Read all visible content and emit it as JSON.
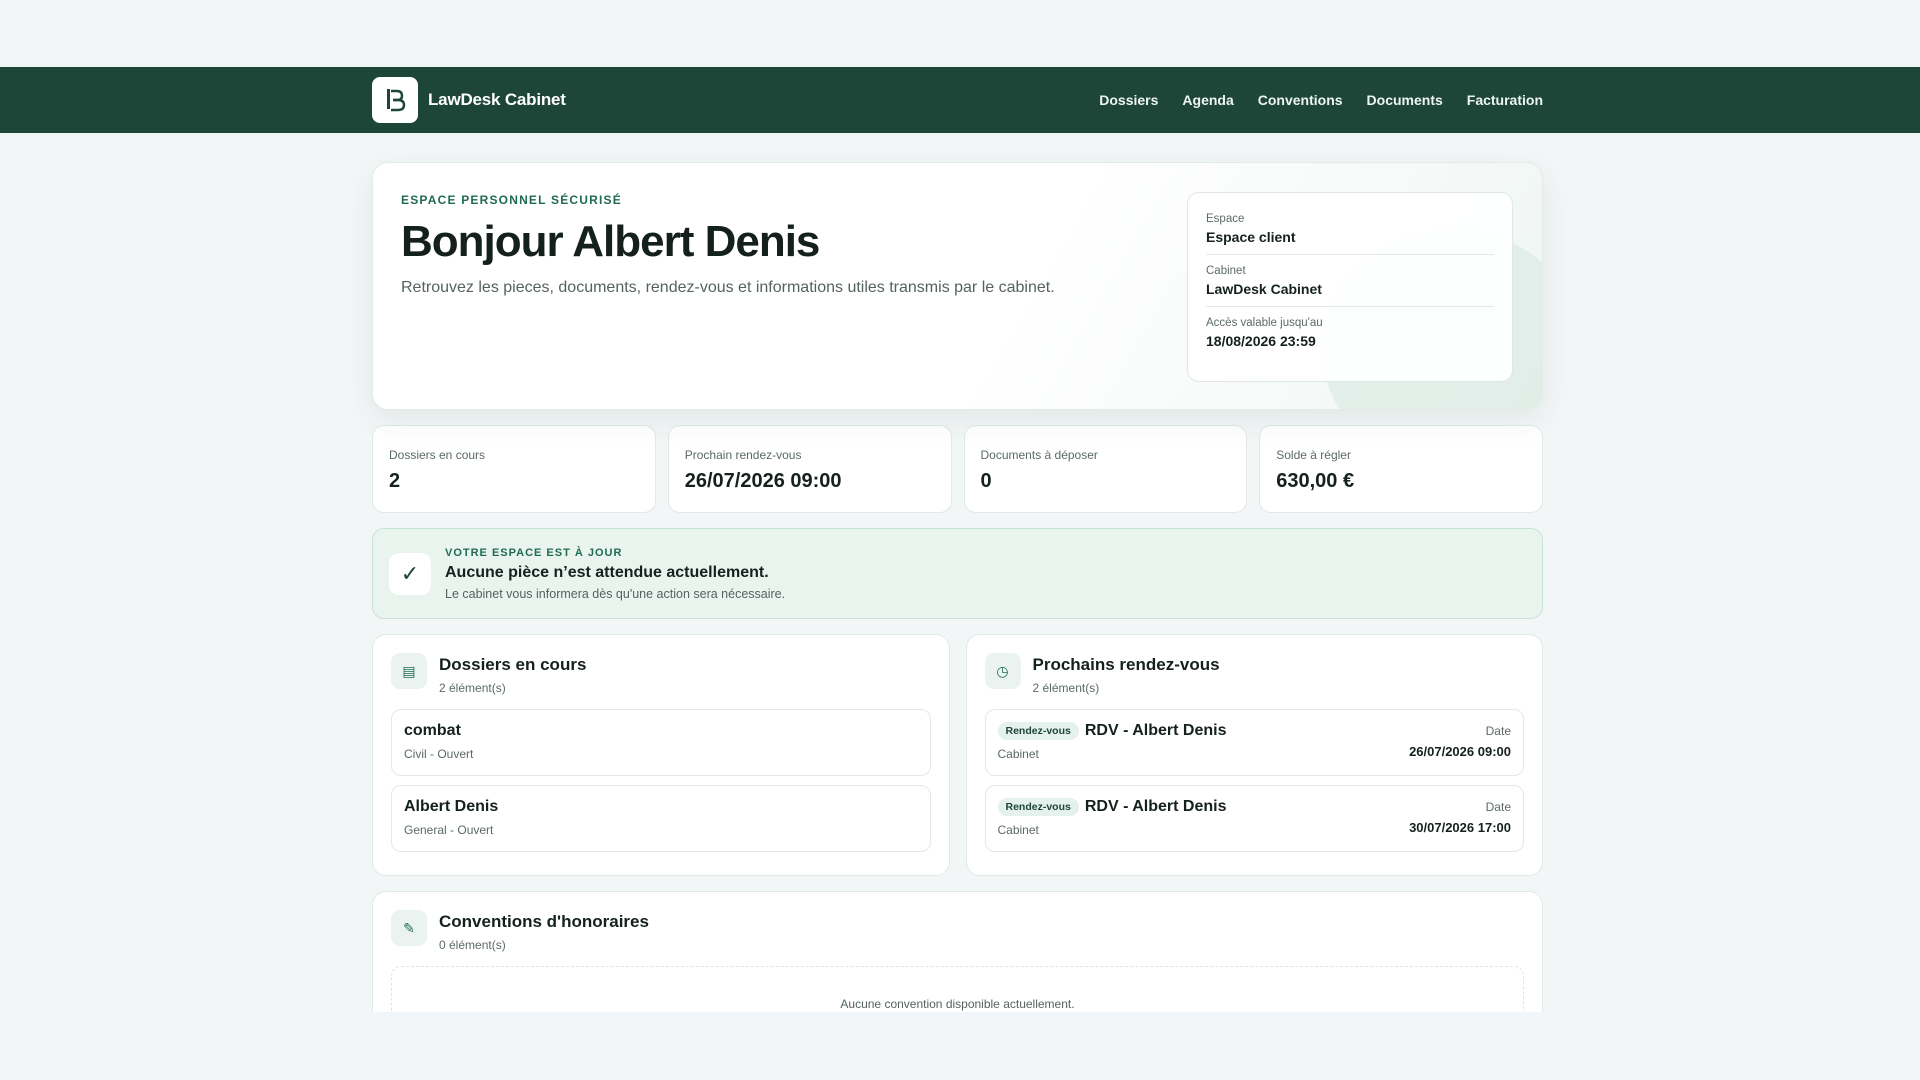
{
  "header": {
    "brand": "LawDesk Cabinet",
    "nav": [
      "Dossiers",
      "Agenda",
      "Conventions",
      "Documents",
      "Facturation"
    ]
  },
  "hero": {
    "eyebrow": "ESPACE PERSONNEL SÉCURISÉ",
    "title": "Bonjour Albert Denis",
    "subtitle": "Retrouvez les pieces, documents, rendez-vous et informations utiles transmis par le cabinet.",
    "info": [
      {
        "label": "Espace",
        "value": "Espace client"
      },
      {
        "label": "Cabinet",
        "value": "LawDesk Cabinet"
      },
      {
        "label": "Accès valable jusqu'au",
        "value": "18/08/2026 23:59"
      }
    ]
  },
  "stats": [
    {
      "label": "Dossiers en cours",
      "value": "2"
    },
    {
      "label": "Prochain rendez-vous",
      "value": "26/07/2026 09:00"
    },
    {
      "label": "Documents à déposer",
      "value": "0"
    },
    {
      "label": "Solde à régler",
      "value": "630,00 €"
    }
  ],
  "alert": {
    "eyebrow": "VOTRE ESPACE EST À JOUR",
    "title": "Aucune pièce n’est attendue actuellement.",
    "subtitle": "Le cabinet vous informera dès qu'une action sera nécessaire."
  },
  "dossiers": {
    "title": "Dossiers en cours",
    "count": "2 élément(s)",
    "items": [
      {
        "title": "combat",
        "sub": "Civil - Ouvert"
      },
      {
        "title": "Albert Denis",
        "sub": "General - Ouvert"
      }
    ]
  },
  "rdv": {
    "title": "Prochains rendez-vous",
    "count": "2 élément(s)",
    "items": [
      {
        "badge": "Rendez-vous",
        "title": "RDV - Albert Denis",
        "sub": "Cabinet",
        "date_label": "Date",
        "date": "26/07/2026 09:00"
      },
      {
        "badge": "Rendez-vous",
        "title": "RDV - Albert Denis",
        "sub": "Cabinet",
        "date_label": "Date",
        "date": "30/07/2026 17:00"
      }
    ]
  },
  "conventions": {
    "title": "Conventions d'honoraires",
    "count": "0 élément(s)",
    "empty": "Aucune convention disponible actuellement."
  },
  "icons": {
    "check": "check-icon",
    "folder": "folder-icon",
    "clock": "clock-icon",
    "pen": "pen-icon"
  }
}
